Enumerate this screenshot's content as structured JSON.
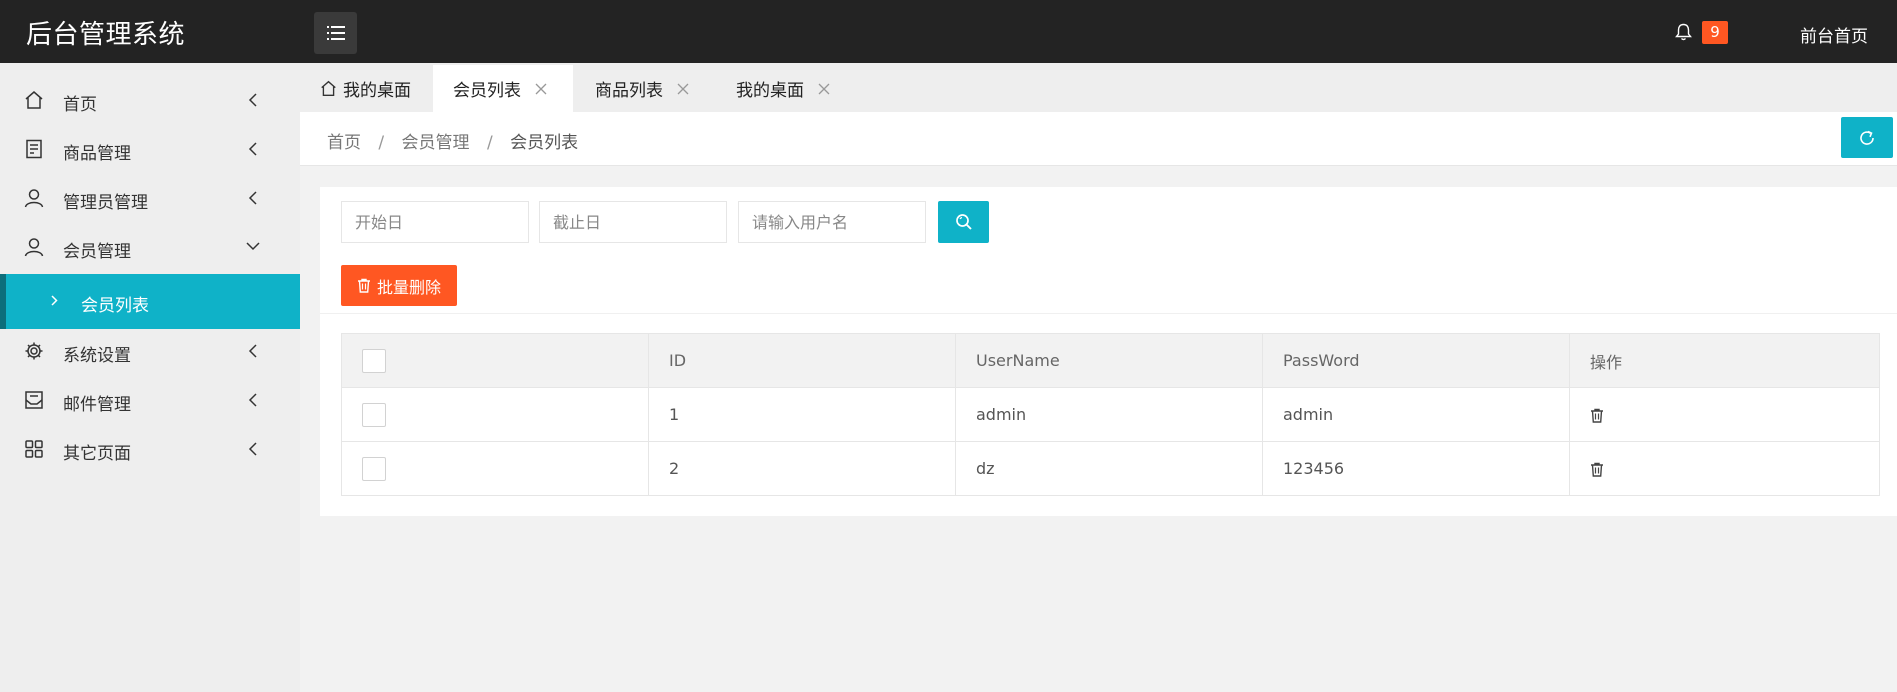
{
  "header": {
    "logo": "后台管理系统",
    "notification_count": "9",
    "front_link": "前台首页"
  },
  "sidebar": {
    "items": [
      {
        "label": "首页",
        "icon": "home-icon"
      },
      {
        "label": "商品管理",
        "icon": "document-icon"
      },
      {
        "label": "管理员管理",
        "icon": "user-icon"
      },
      {
        "label": "会员管理",
        "icon": "user-icon",
        "expanded": true
      },
      {
        "label": "系统设置",
        "icon": "gear-icon"
      },
      {
        "label": "邮件管理",
        "icon": "mail-icon"
      },
      {
        "label": "其它页面",
        "icon": "grid-icon"
      }
    ],
    "sub_item": {
      "label": "会员列表",
      "active": true
    }
  },
  "tabs": [
    {
      "label": "我的桌面",
      "home": true
    },
    {
      "label": "会员列表",
      "active": true
    },
    {
      "label": "商品列表"
    },
    {
      "label": "我的桌面"
    }
  ],
  "breadcrumb": {
    "items": [
      "首页",
      "会员管理",
      "会员列表"
    ],
    "separator": "/"
  },
  "filters": {
    "start_placeholder": "开始日",
    "end_placeholder": "截止日",
    "username_placeholder": "请输入用户名"
  },
  "actions": {
    "bulk_delete_label": "批量删除"
  },
  "table": {
    "headers": [
      "ID",
      "UserName",
      "PassWord",
      "操作"
    ],
    "rows": [
      {
        "id": "1",
        "username": "admin",
        "password": "admin"
      },
      {
        "id": "2",
        "username": "dz",
        "password": "123456"
      }
    ]
  },
  "colors": {
    "header_bg": "#232323",
    "accent": "#0fb2c8",
    "danger": "#ff5722",
    "sidebar_bg": "#eeeeee"
  }
}
